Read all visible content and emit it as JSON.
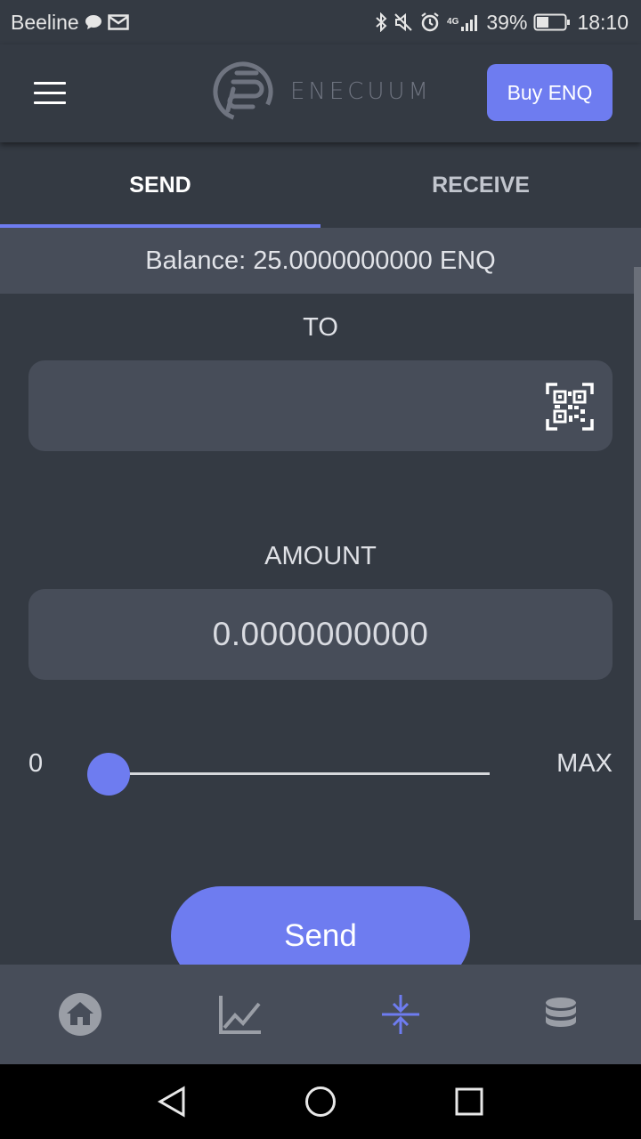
{
  "status_bar": {
    "carrier": "Beeline",
    "network": "4G",
    "battery": "39%",
    "time": "18:10",
    "icons": [
      "chat-bubble-icon",
      "mail-icon",
      "bluetooth-icon",
      "mute-icon",
      "alarm-icon",
      "signal-icon",
      "battery-icon"
    ]
  },
  "app_bar": {
    "logo_text": "ENECUUM",
    "buy_button": "Buy ENQ",
    "menu_icon": "hamburger-menu-icon"
  },
  "tabs": [
    {
      "label": "SEND",
      "active": true
    },
    {
      "label": "RECEIVE",
      "active": false
    }
  ],
  "balance": "Balance: 25.0000000000 ENQ",
  "form": {
    "to_label": "TO",
    "to_value": "",
    "qr_icon": "qr-scan-icon",
    "amount_label": "AMOUNT",
    "amount_value": "0.0000000000",
    "slider": {
      "min_label": "0",
      "max_label": "MAX",
      "fraction": 0.0
    },
    "send_button": "Send"
  },
  "bottom_nav": [
    {
      "name": "home",
      "icon": "home-icon",
      "active": false
    },
    {
      "name": "chart",
      "icon": "chart-icon",
      "active": false
    },
    {
      "name": "transfer",
      "icon": "transfer-icon",
      "active": true
    },
    {
      "name": "stack",
      "icon": "coin-stack-icon",
      "active": false
    }
  ],
  "colors": {
    "accent": "#6e7cf0",
    "background": "#343a43",
    "panel": "#474d59",
    "inactive_icon": "#9a9ea6"
  }
}
